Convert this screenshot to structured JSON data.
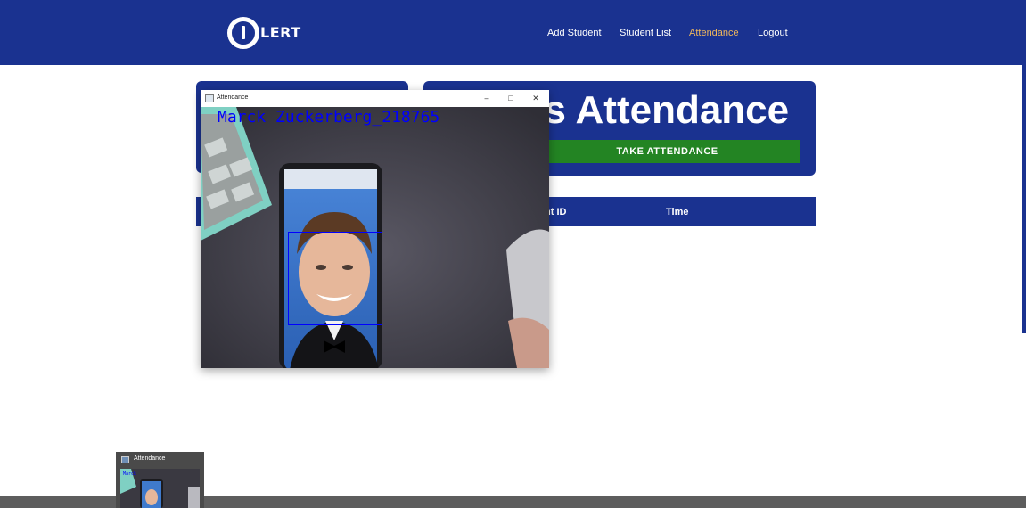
{
  "navbar": {
    "logo_text": "LERT",
    "links": [
      "Add Student",
      "Student List",
      "Attendance",
      "Logout"
    ],
    "active_link": "Attendance",
    "accent_color": "#f0b75c",
    "background_color": "#1a3290"
  },
  "main": {
    "title": "'s Attendance",
    "take_attendance_label": "TAKE ATTENDANCE",
    "table_headers": [
      "nt ID",
      "Time"
    ]
  },
  "camera_window": {
    "title": "Attendance",
    "controls": [
      "minimize-icon",
      "maximize-icon",
      "close-icon"
    ],
    "recognized_label": "Marck Zuckerberg_218765",
    "box_color": "#0000ff"
  },
  "taskbar_preview": {
    "title": "Attendance"
  }
}
